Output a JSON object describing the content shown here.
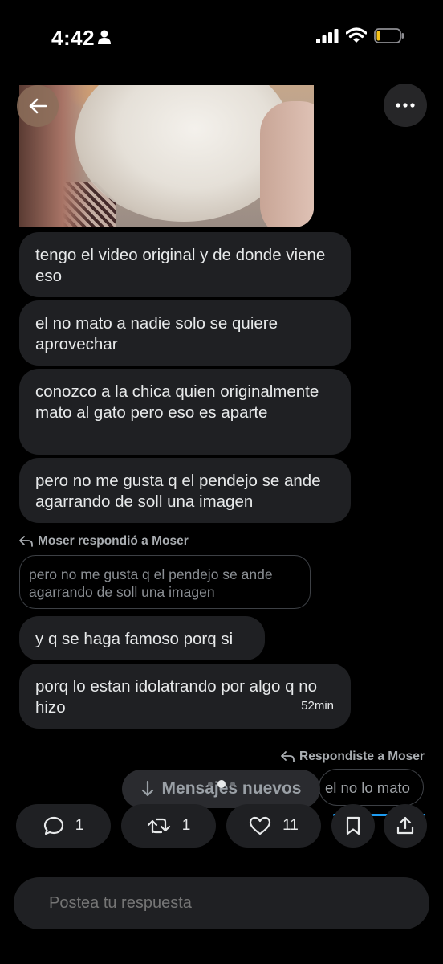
{
  "status_bar": {
    "time": "4:42"
  },
  "messages": [
    {
      "text": "tengo el video original y de donde viene eso"
    },
    {
      "text": "el no mato a nadie solo se quiere aprovechar"
    },
    {
      "text": "conozco a la chica quien originalmente mato al gato pero eso es aparte"
    },
    {
      "text": "pero no me gusta q el pendejo se ande agarrando de soll una imagen"
    }
  ],
  "reply_1": {
    "meta": "Moser respondió a Moser",
    "quote": "pero no me gusta q el pendejo se ande agarrando de soll una imagen"
  },
  "messages_2": [
    {
      "text": "y q se haga famoso porq si"
    },
    {
      "text": "porq lo estan idolatrando por algo q no hizo",
      "time": "52min"
    }
  ],
  "reply_2": {
    "meta": "Respondiste a Moser",
    "own_text": "el no lo mato"
  },
  "new_messages_label": "Mensajes nuevos",
  "actions": {
    "replies": "1",
    "reposts": "1",
    "likes": "11"
  },
  "composer": {
    "placeholder": "Postea tu respuesta"
  },
  "colors": {
    "background": "#000000",
    "bubble": "#1f2023",
    "accent": "#1d9bf0"
  }
}
